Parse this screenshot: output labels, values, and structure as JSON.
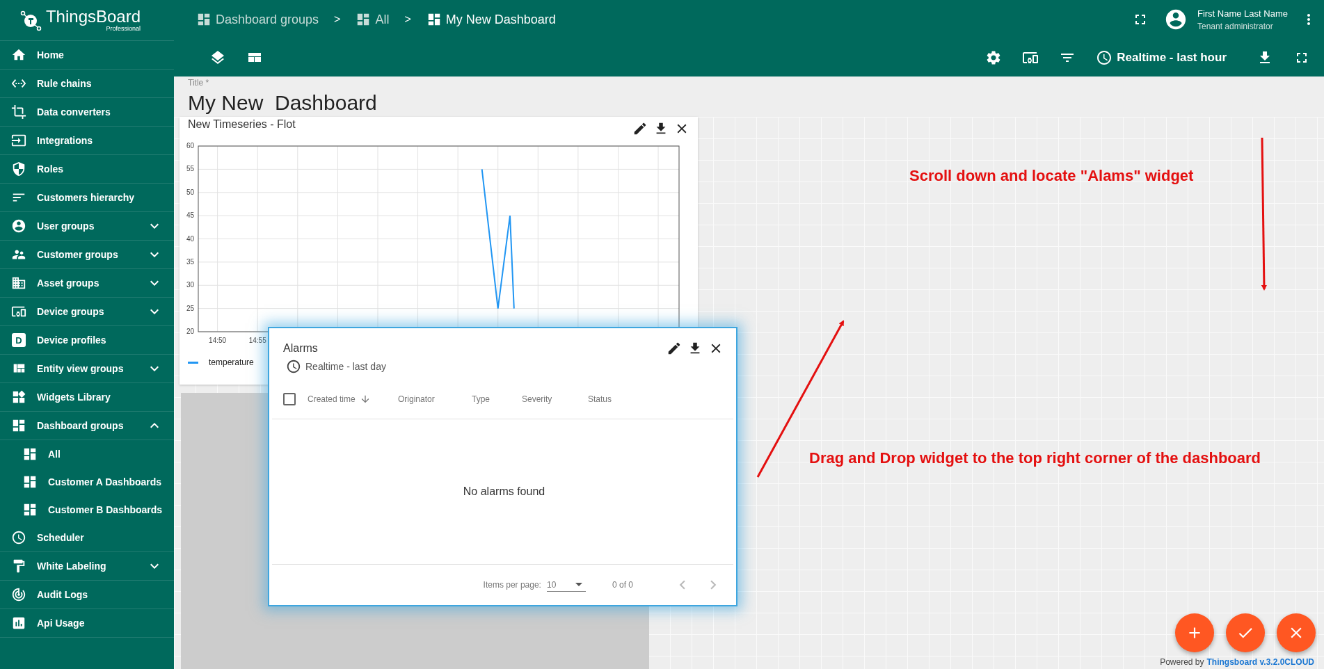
{
  "logo": {
    "name": "ThingsBoard",
    "edition": "Professional"
  },
  "sidebar": {
    "items": [
      {
        "label": "Home"
      },
      {
        "label": "Rule chains"
      },
      {
        "label": "Data converters"
      },
      {
        "label": "Integrations"
      },
      {
        "label": "Roles"
      },
      {
        "label": "Customers hierarchy"
      },
      {
        "label": "User groups",
        "expanded": false
      },
      {
        "label": "Customer groups",
        "expanded": false
      },
      {
        "label": "Asset groups",
        "expanded": false
      },
      {
        "label": "Device groups",
        "expanded": false
      },
      {
        "label": "Device profiles",
        "icon_text": "D"
      },
      {
        "label": "Entity view groups",
        "expanded": false
      },
      {
        "label": "Widgets Library"
      },
      {
        "label": "Dashboard groups",
        "expanded": true,
        "children": [
          {
            "label": "All"
          },
          {
            "label": "Customer A Dashboards"
          },
          {
            "label": "Customer B Dashboards"
          }
        ]
      },
      {
        "label": "Scheduler"
      },
      {
        "label": "White Labeling",
        "expanded": false
      },
      {
        "label": "Audit Logs"
      },
      {
        "label": "Api Usage"
      }
    ]
  },
  "breadcrumbs": [
    {
      "label": "Dashboard groups",
      "selected": false
    },
    {
      "separator": ">",
      "label": "All",
      "selected": false
    },
    {
      "separator": ">",
      "label": "My New Dashboard",
      "selected": true
    }
  ],
  "user": {
    "name": "First Name Last Name",
    "role": "Tenant administrator"
  },
  "toolbar": {
    "timewindow": "Realtime - last hour"
  },
  "title": {
    "label": "Title *",
    "value": "My New  Dashboard"
  },
  "chart_widget": {
    "title": "New Timeseries - Flot",
    "chart_data": {
      "type": "line",
      "grid": true,
      "x": [
        923,
        925,
        926.5,
        927
      ],
      "series": [
        {
          "name": "temperature",
          "color": "#2196f3",
          "values": [
            55,
            25,
            45,
            25
          ]
        }
      ],
      "xlim": [
        887.6,
        947.6
      ],
      "ylim": [
        20,
        60
      ],
      "xticks": [
        {
          "value": 890,
          "label": "14:50"
        },
        {
          "value": 895,
          "label": "14:55"
        }
      ],
      "yticks": [
        20,
        25,
        30,
        35,
        40,
        45,
        50,
        55,
        60
      ]
    }
  },
  "alarms_widget": {
    "title": "Alarms",
    "timewindow": "Realtime - last day",
    "select_all_checked": false,
    "columns": [
      {
        "label": "Created time",
        "sorted": true
      },
      {
        "label": "Originator",
        "sorted": false
      },
      {
        "label": "Type",
        "sorted": false
      },
      {
        "label": "Severity",
        "sorted": false
      },
      {
        "label": "Status",
        "sorted": false
      }
    ],
    "empty_message": "No alarms found",
    "items_per_page_label": "Items per page:",
    "items_per_page": "10",
    "range": "0 of 0",
    "prev_disabled": true,
    "next_disabled": true
  },
  "annotations": [
    "Scroll down and locate \"Alams\" widget",
    "Drag and Drop widget to the top right corner of the dashboard"
  ],
  "footer": {
    "prefix": "Powered by",
    "link": "Thingsboard v.3.2.0CLOUD"
  }
}
